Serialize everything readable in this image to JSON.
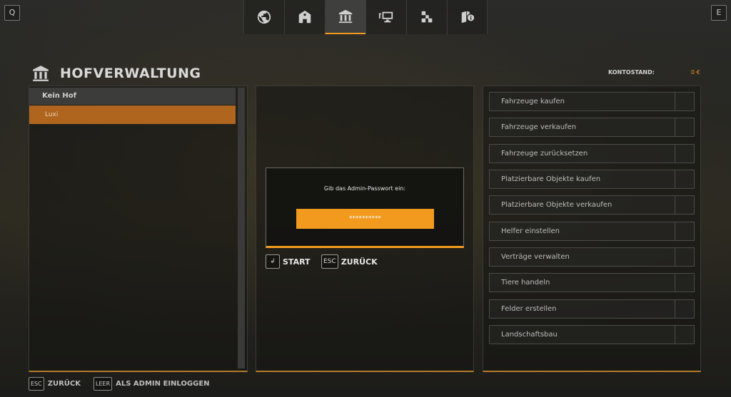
{
  "topbar": {
    "left_key": "Q",
    "right_key": "E",
    "tabs": [
      {
        "icon": "globe-icon",
        "active": false
      },
      {
        "icon": "barn-icon",
        "active": false
      },
      {
        "icon": "farm-management-icon",
        "active": true
      },
      {
        "icon": "network-icon",
        "active": false
      },
      {
        "icon": "boxes-icon",
        "active": false
      },
      {
        "icon": "info-book-icon",
        "active": false
      }
    ]
  },
  "header": {
    "title": "HOFVERWALTUNG",
    "konto_label": "KONTOSTAND:",
    "konto_value": "0 €"
  },
  "farms": {
    "header": "Kein Hof",
    "items": [
      "Luxi"
    ]
  },
  "dialog": {
    "prompt": "Gib das Admin-Passwort ein:",
    "password_value": "**********",
    "start_key": "↲",
    "start_label": "START",
    "back_key": "ESC",
    "back_label": "ZURÜCK"
  },
  "menu": {
    "items": [
      "Fahrzeuge kaufen",
      "Fahrzeuge verkaufen",
      "Fahrzeuge zurücksetzen",
      "Platzierbare Objekte kaufen",
      "Platzierbare Objekte verkaufen",
      "Helfer einstellen",
      "Verträge verwalten",
      "Tiere handeln",
      "Felder erstellen",
      "Landschaftsbau"
    ]
  },
  "footer": {
    "back_key": "ESC",
    "back_label": "ZURÜCK",
    "admin_key": "LEER",
    "admin_label": "ALS ADMIN EINLOGGEN"
  },
  "colors": {
    "accent": "#f29a1e",
    "selected_row": "#b0651e"
  }
}
